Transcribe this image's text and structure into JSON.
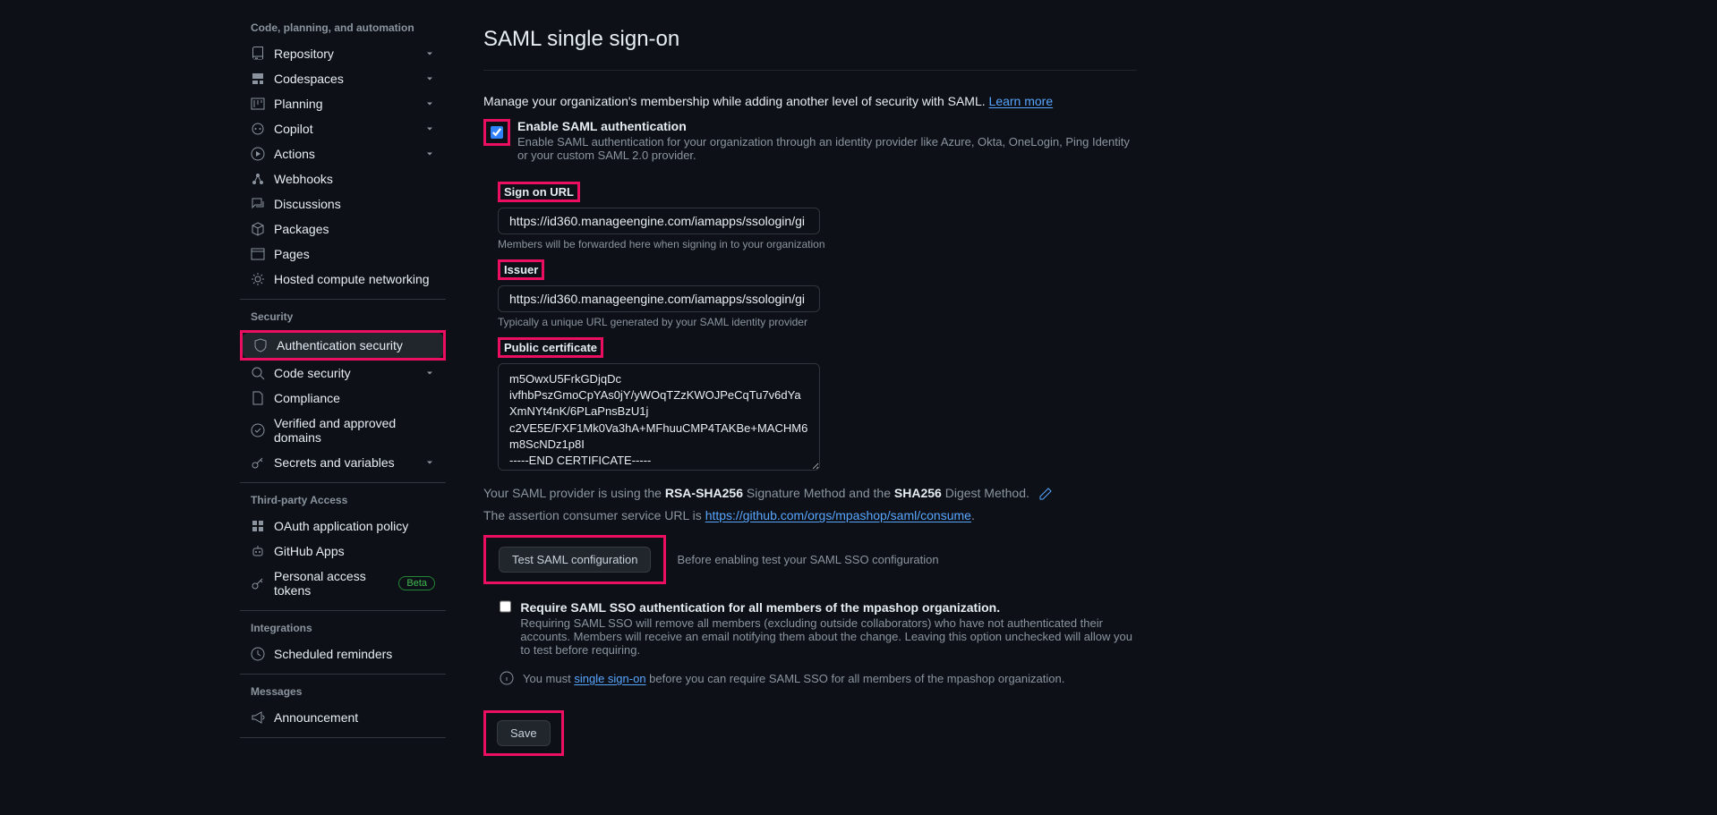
{
  "sidebar": {
    "sections": [
      {
        "header": "Code, planning, and automation",
        "items": [
          {
            "label": "Repository",
            "icon": "repo",
            "chevron": true
          },
          {
            "label": "Codespaces",
            "icon": "codespaces",
            "chevron": true
          },
          {
            "label": "Planning",
            "icon": "project",
            "chevron": true
          },
          {
            "label": "Copilot",
            "icon": "copilot",
            "chevron": true
          },
          {
            "label": "Actions",
            "icon": "play",
            "chevron": true
          },
          {
            "label": "Webhooks",
            "icon": "webhook",
            "chevron": false
          },
          {
            "label": "Discussions",
            "icon": "discussions",
            "chevron": false
          },
          {
            "label": "Packages",
            "icon": "package",
            "chevron": false
          },
          {
            "label": "Pages",
            "icon": "browser",
            "chevron": false
          },
          {
            "label": "Hosted compute networking",
            "icon": "gear",
            "chevron": false
          }
        ]
      },
      {
        "header": "Security",
        "items": [
          {
            "label": "Authentication security",
            "icon": "shield",
            "active": true,
            "highlight": true
          },
          {
            "label": "Code security",
            "icon": "codescan",
            "chevron": true
          },
          {
            "label": "Compliance",
            "icon": "file",
            "chevron": false
          },
          {
            "label": "Verified and approved domains",
            "icon": "verified",
            "chevron": false
          },
          {
            "label": "Secrets and variables",
            "icon": "key",
            "chevron": true
          }
        ]
      },
      {
        "header": "Third-party Access",
        "items": [
          {
            "label": "OAuth application policy",
            "icon": "apps",
            "chevron": false
          },
          {
            "label": "GitHub Apps",
            "icon": "hubot",
            "chevron": false
          },
          {
            "label": "Personal access tokens",
            "icon": "key",
            "beta": true
          }
        ]
      },
      {
        "header": "Integrations",
        "items": [
          {
            "label": "Scheduled reminders",
            "icon": "clock",
            "chevron": false
          }
        ]
      },
      {
        "header": "Messages",
        "items": [
          {
            "label": "Announcement",
            "icon": "megaphone",
            "chevron": false
          }
        ]
      }
    ],
    "beta_label": "Beta"
  },
  "main": {
    "title": "SAML single sign-on",
    "subhead": "Manage your organization's membership while adding another level of security with SAML.",
    "learn_more": "Learn more",
    "enable": {
      "title": "Enable SAML authentication",
      "desc": "Enable SAML authentication for your organization through an identity provider like Azure, Okta, OneLogin, Ping Identity or your custom SAML 2.0 provider.",
      "checked": true
    },
    "signon": {
      "label": "Sign on URL",
      "value": "https://id360.manageengine.com/iamapps/ssologin/gi",
      "help": "Members will be forwarded here when signing in to your organization"
    },
    "issuer": {
      "label": "Issuer",
      "value": "https://id360.manageengine.com/iamapps/ssologin/gi",
      "help": "Typically a unique URL generated by your SAML identity provider"
    },
    "cert": {
      "label": "Public certificate",
      "value": "m5OwxU5FrkGDjqDc\nivfhbPszGmoCpYAs0jY/yWOqTZzKWOJPeCqTu7v6dYaXmNYt4nK/6PLaPnsBzU1j\nc2VE5E/FXF1Mk0Va3hA+MFhuuCMP4TAKBe+MACHM6m8ScNDz1p8I\n-----END CERTIFICATE-----"
    },
    "provider_info": {
      "prefix": "Your SAML provider is using the",
      "sig_method": "RSA-SHA256",
      "sig_label": " Signature Method",
      "and": " and the ",
      "digest_method": "SHA256",
      "digest_label": " Digest Method."
    },
    "consumer": {
      "prefix": "The assertion consumer service URL is ",
      "url": "https://github.com/orgs/mpashop/saml/consume",
      "suffix": "."
    },
    "test": {
      "button": "Test SAML configuration",
      "desc": "Before enabling test your SAML SSO configuration"
    },
    "require": {
      "checked": false,
      "title": "Require SAML SSO authentication for all members of the mpashop organization.",
      "desc": "Requiring SAML SSO will remove all members (excluding outside collaborators) who have not authenticated their accounts. Members will receive an email notifying them about the change. Leaving this option unchecked will allow you to test before requiring."
    },
    "must": {
      "prefix": "You must ",
      "link": "single sign-on",
      "suffix": " before you can require SAML SSO for all members of the mpashop organization."
    },
    "save": "Save"
  }
}
